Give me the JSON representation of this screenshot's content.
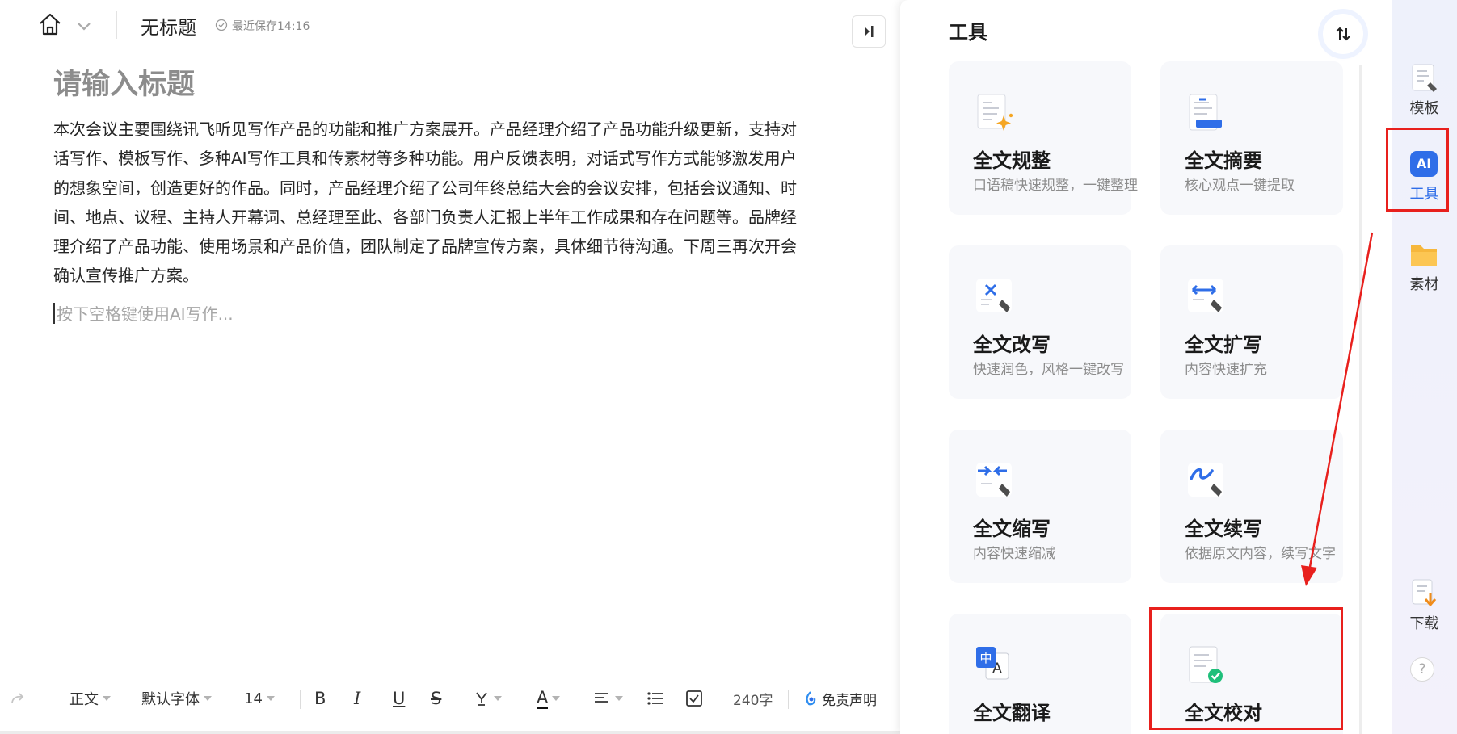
{
  "topbar": {
    "doc_title": "无标题",
    "save_status": "最近保存14:16"
  },
  "editor": {
    "title_placeholder": "请输入标题",
    "body": "本次会议主要围绕讯飞听见写作产品的功能和推广方案展开。产品经理介绍了产品功能升级更新，支持对话写作、模板写作、多种AI写作工具和传素材等多种功能。用户反馈表明，对话式写作方式能够激发用户的想象空间，创造更好的作品。同时，产品经理介绍了公司年终总结大会的会议安排，包括会议通知、时间、地点、议程、主持人开幕词、总经理至此、各部门负责人汇报上半年工作成果和存在问题等。品牌经理介绍了产品功能、使用场景和产品价值，团队制定了品牌宣传方案，具体细节待沟通。下周三再次开会确认宣传推广方案。",
    "ai_hint": "按下空格键使用AI写作..."
  },
  "toolbar": {
    "style": "正文",
    "font": "默认字体",
    "size": "14",
    "bold": "B",
    "italic": "I",
    "underline": "U",
    "strike": "S",
    "font_color": "A",
    "word_count": "240字",
    "disclaimer": "免责声明"
  },
  "panel": {
    "title": "工具",
    "cards": [
      {
        "title": "全文规整",
        "desc": "口语稿快速规整，一键整理",
        "icon": "doc-sparkle-icon"
      },
      {
        "title": "全文摘要",
        "desc": "核心观点一键提取",
        "icon": "doc-summary-icon"
      },
      {
        "title": "全文改写",
        "desc": "快速润色，风格一键改写",
        "icon": "rewrite-icon"
      },
      {
        "title": "全文扩写",
        "desc": "内容快速扩充",
        "icon": "expand-icon"
      },
      {
        "title": "全文缩写",
        "desc": "内容快速缩减",
        "icon": "shrink-icon"
      },
      {
        "title": "全文续写",
        "desc": "依据原文内容，续写文字",
        "icon": "continue-icon"
      },
      {
        "title": "全文翻译",
        "desc": "",
        "icon": "translate-icon"
      },
      {
        "title": "全文校对",
        "desc": "",
        "icon": "proofread-icon"
      }
    ]
  },
  "rail": {
    "template": "模板",
    "ai_badge": "AI",
    "tools": "工具",
    "material": "素材",
    "download": "下载",
    "help": "?"
  },
  "colors": {
    "accent_blue": "#2f6ee8",
    "highlight_red": "#e8201d",
    "card_bg": "#f7f8fb"
  }
}
